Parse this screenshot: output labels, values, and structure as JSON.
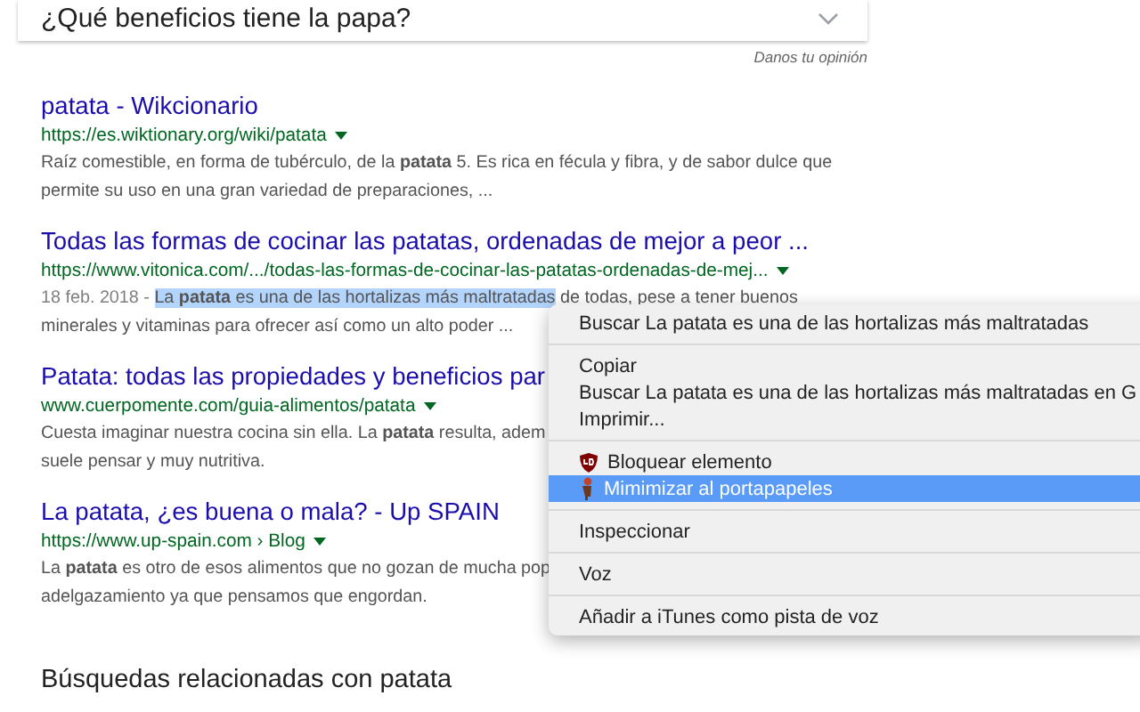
{
  "question_box": {
    "question": "¿Qué beneficios tiene la papa?",
    "expanded": false
  },
  "feedback_link": "Danos tu opinión",
  "results": [
    {
      "title": "patata - Wikcionario",
      "url": "https://es.wiktionary.org/wiki/patata",
      "snippet_lines": [
        {
          "text": "Raíz comestible, en forma de tubérculo, de la **patata** 5. Es rica en fécula y fibra, y de sabor dulce que"
        },
        {
          "text": "permite su uso en una gran variedad de preparaciones, ..."
        }
      ]
    },
    {
      "title": "Todas las formas de cocinar las patatas, ordenadas de mejor a peor ...",
      "url": "https://www.vitonica.com/.../todas-las-formas-de-cocinar-las-patatas-ordenadas-de-mej...",
      "snippet_lines": [
        {
          "date": "18 feb. 2018 - ",
          "selected_text": "La **patata** es una de las hortalizas más maltratadas",
          "text": " de todas, pese a tener buenos"
        },
        {
          "text": "minerales y vitaminas para ofrecer así como un alto poder ..."
        }
      ]
    },
    {
      "title": "Patata: todas las propiedades y beneficios par",
      "url": "www.cuerpomente.com/guia-alimentos/patata",
      "snippet_lines": [
        {
          "text": "Cuesta imaginar nuestra cocina sin ella. La **patata** resulta, adem"
        },
        {
          "text": "suele pensar y muy nutritiva."
        }
      ]
    },
    {
      "title": "La patata, ¿es buena o mala? - Up SPAIN",
      "url": "https://www.up-spain.com › Blog",
      "snippet_lines": [
        {
          "text": "La **patata** es otro de esos alimentos que no gozan de mucha pop"
        },
        {
          "text": "adelgazamiento ya que pensamos que engordan."
        }
      ]
    }
  ],
  "related_heading": "Búsquedas relacionadas con patata",
  "context_menu": {
    "groups": [
      [
        {
          "label": "Buscar La patata es una de las hortalizas más maltratadas",
          "kind": "plain",
          "selected": false
        }
      ],
      [
        {
          "label": "Copiar",
          "kind": "plain",
          "selected": false
        },
        {
          "label": "Buscar La patata es una de las hortalizas más maltratadas en G",
          "kind": "plain",
          "selected": false
        },
        {
          "label": "Imprimir...",
          "kind": "plain",
          "selected": false
        }
      ],
      [
        {
          "label": "Bloquear elemento",
          "kind": "shield-extension",
          "selected": false
        },
        {
          "label": "Mimimizar al portapapeles",
          "kind": "figure-extension",
          "selected": true
        }
      ],
      [
        {
          "label": "Inspeccionar",
          "kind": "plain",
          "selected": false
        }
      ],
      [
        {
          "label": "Voz",
          "kind": "plain",
          "selected": false
        }
      ],
      [
        {
          "label": "Añadir a iTunes como pista de voz",
          "kind": "plain",
          "selected": false
        }
      ]
    ]
  }
}
